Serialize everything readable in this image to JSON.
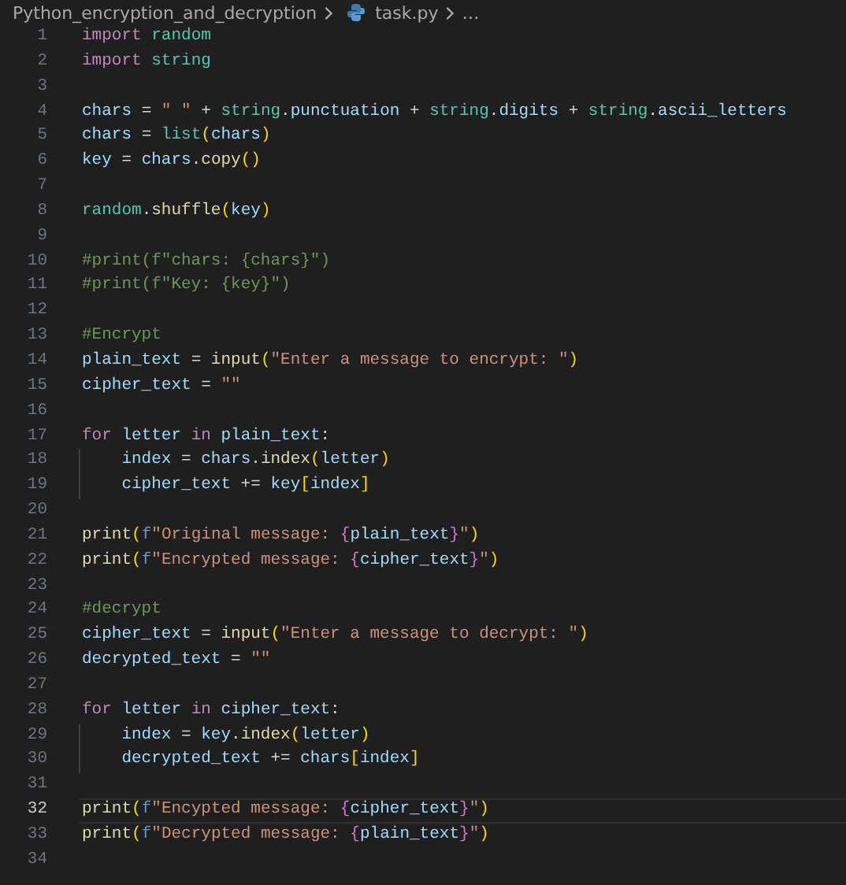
{
  "breadcrumb": {
    "folder": "Python_encryption_and_decryption",
    "file": "task.py",
    "more": "…"
  },
  "lines": [
    {
      "number": "1",
      "current": false,
      "indented": false,
      "tokens": [
        {
          "kind": "kw",
          "text": "import "
        },
        {
          "kind": "mod",
          "text": "random"
        }
      ]
    },
    {
      "number": "2",
      "current": false,
      "indented": false,
      "tokens": [
        {
          "kind": "kw",
          "text": "import "
        },
        {
          "kind": "mod",
          "text": "string"
        }
      ]
    },
    {
      "number": "3",
      "current": false,
      "indented": false
    },
    {
      "number": "4",
      "current": false,
      "indented": false,
      "tokens": [
        {
          "kind": "var",
          "text": "chars"
        },
        {
          "kind": "op",
          "text": " = "
        },
        {
          "kind": "str",
          "text": "\" \""
        },
        {
          "kind": "op",
          "text": " + "
        },
        {
          "kind": "mod",
          "text": "string"
        },
        {
          "kind": "op",
          "text": "."
        },
        {
          "kind": "var",
          "text": "punctuation"
        },
        {
          "kind": "op",
          "text": " + "
        },
        {
          "kind": "mod",
          "text": "string"
        },
        {
          "kind": "op",
          "text": "."
        },
        {
          "kind": "var",
          "text": "digits"
        },
        {
          "kind": "op",
          "text": " + "
        },
        {
          "kind": "mod",
          "text": "string"
        },
        {
          "kind": "op",
          "text": "."
        },
        {
          "kind": "var",
          "text": "ascii_letters"
        }
      ]
    },
    {
      "number": "5",
      "current": false,
      "indented": false,
      "tokens": [
        {
          "kind": "var",
          "text": "chars"
        },
        {
          "kind": "op",
          "text": " = "
        },
        {
          "kind": "mod",
          "text": "list"
        },
        {
          "kind": "br1",
          "text": "("
        },
        {
          "kind": "var",
          "text": "chars"
        },
        {
          "kind": "br1",
          "text": ")"
        }
      ]
    },
    {
      "number": "6",
      "current": false,
      "indented": false,
      "tokens": [
        {
          "kind": "var",
          "text": "key"
        },
        {
          "kind": "op",
          "text": " = "
        },
        {
          "kind": "var",
          "text": "chars"
        },
        {
          "kind": "op",
          "text": "."
        },
        {
          "kind": "fn",
          "text": "copy"
        },
        {
          "kind": "br1",
          "text": "()"
        }
      ]
    },
    {
      "number": "7",
      "current": false,
      "indented": false
    },
    {
      "number": "8",
      "current": false,
      "indented": false,
      "tokens": [
        {
          "kind": "mod",
          "text": "random"
        },
        {
          "kind": "op",
          "text": "."
        },
        {
          "kind": "fn",
          "text": "shuffle"
        },
        {
          "kind": "br1",
          "text": "("
        },
        {
          "kind": "var",
          "text": "key"
        },
        {
          "kind": "br1",
          "text": ")"
        }
      ]
    },
    {
      "number": "9",
      "current": false,
      "indented": false
    },
    {
      "number": "10",
      "current": false,
      "indented": false,
      "tokens": [
        {
          "kind": "cmt",
          "text": "#print(f\"chars: {chars}\")"
        }
      ]
    },
    {
      "number": "11",
      "current": false,
      "indented": false,
      "tokens": [
        {
          "kind": "cmt",
          "text": "#print(f\"Key: {key}\")"
        }
      ]
    },
    {
      "number": "12",
      "current": false,
      "indented": false
    },
    {
      "number": "13",
      "current": false,
      "indented": false,
      "tokens": [
        {
          "kind": "cmt",
          "text": "#Encrypt"
        }
      ]
    },
    {
      "number": "14",
      "current": false,
      "indented": false,
      "tokens": [
        {
          "kind": "var",
          "text": "plain_text"
        },
        {
          "kind": "op",
          "text": " = "
        },
        {
          "kind": "fn",
          "text": "input"
        },
        {
          "kind": "br1",
          "text": "("
        },
        {
          "kind": "str",
          "text": "\"Enter a message to encrypt: \""
        },
        {
          "kind": "br1",
          "text": ")"
        }
      ]
    },
    {
      "number": "15",
      "current": false,
      "indented": false,
      "tokens": [
        {
          "kind": "var",
          "text": "cipher_text"
        },
        {
          "kind": "op",
          "text": " = "
        },
        {
          "kind": "str",
          "text": "\"\""
        }
      ]
    },
    {
      "number": "16",
      "current": false,
      "indented": false
    },
    {
      "number": "17",
      "current": false,
      "indented": false,
      "tokens": [
        {
          "kind": "kw",
          "text": "for "
        },
        {
          "kind": "var",
          "text": "letter "
        },
        {
          "kind": "kw",
          "text": "in "
        },
        {
          "kind": "var",
          "text": "plain_text"
        },
        {
          "kind": "op",
          "text": ":"
        }
      ]
    },
    {
      "number": "18",
      "current": false,
      "indented": true,
      "tokens": [
        {
          "kind": "var",
          "text": "index"
        },
        {
          "kind": "op",
          "text": " = "
        },
        {
          "kind": "var",
          "text": "chars"
        },
        {
          "kind": "op",
          "text": "."
        },
        {
          "kind": "fn",
          "text": "index"
        },
        {
          "kind": "br1",
          "text": "("
        },
        {
          "kind": "var",
          "text": "letter"
        },
        {
          "kind": "br1",
          "text": ")"
        }
      ]
    },
    {
      "number": "19",
      "current": false,
      "indented": true,
      "tokens": [
        {
          "kind": "var",
          "text": "cipher_text"
        },
        {
          "kind": "op",
          "text": " += "
        },
        {
          "kind": "var",
          "text": "key"
        },
        {
          "kind": "br1",
          "text": "["
        },
        {
          "kind": "var",
          "text": "index"
        },
        {
          "kind": "br1",
          "text": "]"
        }
      ]
    },
    {
      "number": "20",
      "current": false,
      "indented": false
    },
    {
      "number": "21",
      "current": false,
      "indented": false,
      "tokens": [
        {
          "kind": "fn",
          "text": "print"
        },
        {
          "kind": "br1",
          "text": "("
        },
        {
          "kind": "fpre",
          "text": "f"
        },
        {
          "kind": "str",
          "text": "\"Original message: "
        },
        {
          "kind": "br2",
          "text": "{"
        },
        {
          "kind": "var",
          "text": "plain_text"
        },
        {
          "kind": "br2",
          "text": "}"
        },
        {
          "kind": "str",
          "text": "\""
        },
        {
          "kind": "br1",
          "text": ")"
        }
      ]
    },
    {
      "number": "22",
      "current": false,
      "indented": false,
      "tokens": [
        {
          "kind": "fn",
          "text": "print"
        },
        {
          "kind": "br1",
          "text": "("
        },
        {
          "kind": "fpre",
          "text": "f"
        },
        {
          "kind": "str",
          "text": "\"Encrypted message: "
        },
        {
          "kind": "br2",
          "text": "{"
        },
        {
          "kind": "var",
          "text": "cipher_text"
        },
        {
          "kind": "br2",
          "text": "}"
        },
        {
          "kind": "str",
          "text": "\""
        },
        {
          "kind": "br1",
          "text": ")"
        }
      ]
    },
    {
      "number": "23",
      "current": false,
      "indented": false
    },
    {
      "number": "24",
      "current": false,
      "indented": false,
      "tokens": [
        {
          "kind": "cmt",
          "text": "#decrypt"
        }
      ]
    },
    {
      "number": "25",
      "current": false,
      "indented": false,
      "tokens": [
        {
          "kind": "var",
          "text": "cipher_text"
        },
        {
          "kind": "op",
          "text": " = "
        },
        {
          "kind": "fn",
          "text": "input"
        },
        {
          "kind": "br1",
          "text": "("
        },
        {
          "kind": "str",
          "text": "\"Enter a message to decrypt: \""
        },
        {
          "kind": "br1",
          "text": ")"
        }
      ]
    },
    {
      "number": "26",
      "current": false,
      "indented": false,
      "tokens": [
        {
          "kind": "var",
          "text": "decrypted_text"
        },
        {
          "kind": "op",
          "text": " = "
        },
        {
          "kind": "str",
          "text": "\"\""
        }
      ]
    },
    {
      "number": "27",
      "current": false,
      "indented": false
    },
    {
      "number": "28",
      "current": false,
      "indented": false,
      "tokens": [
        {
          "kind": "kw",
          "text": "for "
        },
        {
          "kind": "var",
          "text": "letter "
        },
        {
          "kind": "kw",
          "text": "in "
        },
        {
          "kind": "var",
          "text": "cipher_text"
        },
        {
          "kind": "op",
          "text": ":"
        }
      ]
    },
    {
      "number": "29",
      "current": false,
      "indented": true,
      "tokens": [
        {
          "kind": "var",
          "text": "index"
        },
        {
          "kind": "op",
          "text": " = "
        },
        {
          "kind": "var",
          "text": "key"
        },
        {
          "kind": "op",
          "text": "."
        },
        {
          "kind": "fn",
          "text": "index"
        },
        {
          "kind": "br1",
          "text": "("
        },
        {
          "kind": "var",
          "text": "letter"
        },
        {
          "kind": "br1",
          "text": ")"
        }
      ]
    },
    {
      "number": "30",
      "current": false,
      "indented": true,
      "tokens": [
        {
          "kind": "var",
          "text": "decrypted_text"
        },
        {
          "kind": "op",
          "text": " += "
        },
        {
          "kind": "var",
          "text": "chars"
        },
        {
          "kind": "br1",
          "text": "["
        },
        {
          "kind": "var",
          "text": "index"
        },
        {
          "kind": "br1",
          "text": "]"
        }
      ]
    },
    {
      "number": "31",
      "current": false,
      "indented": false
    },
    {
      "number": "32",
      "current": true,
      "indented": false,
      "tokens": [
        {
          "kind": "fn",
          "text": "print"
        },
        {
          "kind": "br1",
          "text": "("
        },
        {
          "kind": "fpre",
          "text": "f"
        },
        {
          "kind": "str",
          "text": "\"Encypted message: "
        },
        {
          "kind": "br2",
          "text": "{"
        },
        {
          "kind": "var",
          "text": "cipher_text"
        },
        {
          "kind": "br2",
          "text": "}"
        },
        {
          "kind": "str",
          "text": "\""
        },
        {
          "kind": "br1",
          "text": ")"
        }
      ]
    },
    {
      "number": "33",
      "current": false,
      "indented": false,
      "tokens": [
        {
          "kind": "fn",
          "text": "print"
        },
        {
          "kind": "br1",
          "text": "("
        },
        {
          "kind": "fpre",
          "text": "f"
        },
        {
          "kind": "str",
          "text": "\"Decrypted message: "
        },
        {
          "kind": "br2",
          "text": "{"
        },
        {
          "kind": "var",
          "text": "plain_text"
        },
        {
          "kind": "br2",
          "text": "}"
        },
        {
          "kind": "str",
          "text": "\""
        },
        {
          "kind": "br1",
          "text": ")"
        }
      ]
    },
    {
      "number": "34",
      "current": false,
      "indented": false
    }
  ]
}
